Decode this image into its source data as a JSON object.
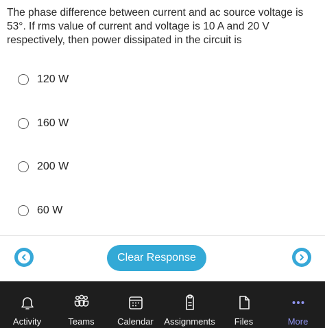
{
  "question": {
    "text": "The phase difference between current and ac source voltage is 53°. If rms value of current and voltage is 10 A and 20 V respectively, then power dissipated in the circuit is"
  },
  "options": [
    {
      "label": "120 W"
    },
    {
      "label": "160 W"
    },
    {
      "label": "200 W"
    },
    {
      "label": "60 W"
    }
  ],
  "controls": {
    "prev_icon": "chevron-left-icon",
    "next_icon": "chevron-right-icon",
    "clear_label": "Clear Response"
  },
  "colors": {
    "accent": "#33a9d6",
    "tabbar_bg": "#1e1e1e",
    "active_tab": "#8f94ee"
  },
  "tabbar": {
    "active": "More",
    "tabs": [
      {
        "label": "Activity",
        "icon": "bell-icon"
      },
      {
        "label": "Teams",
        "icon": "teams-icon"
      },
      {
        "label": "Calendar",
        "icon": "calendar-icon"
      },
      {
        "label": "Assignments",
        "icon": "assignments-icon"
      },
      {
        "label": "Files",
        "icon": "file-icon"
      },
      {
        "label": "More",
        "icon": "more-icon"
      }
    ]
  }
}
